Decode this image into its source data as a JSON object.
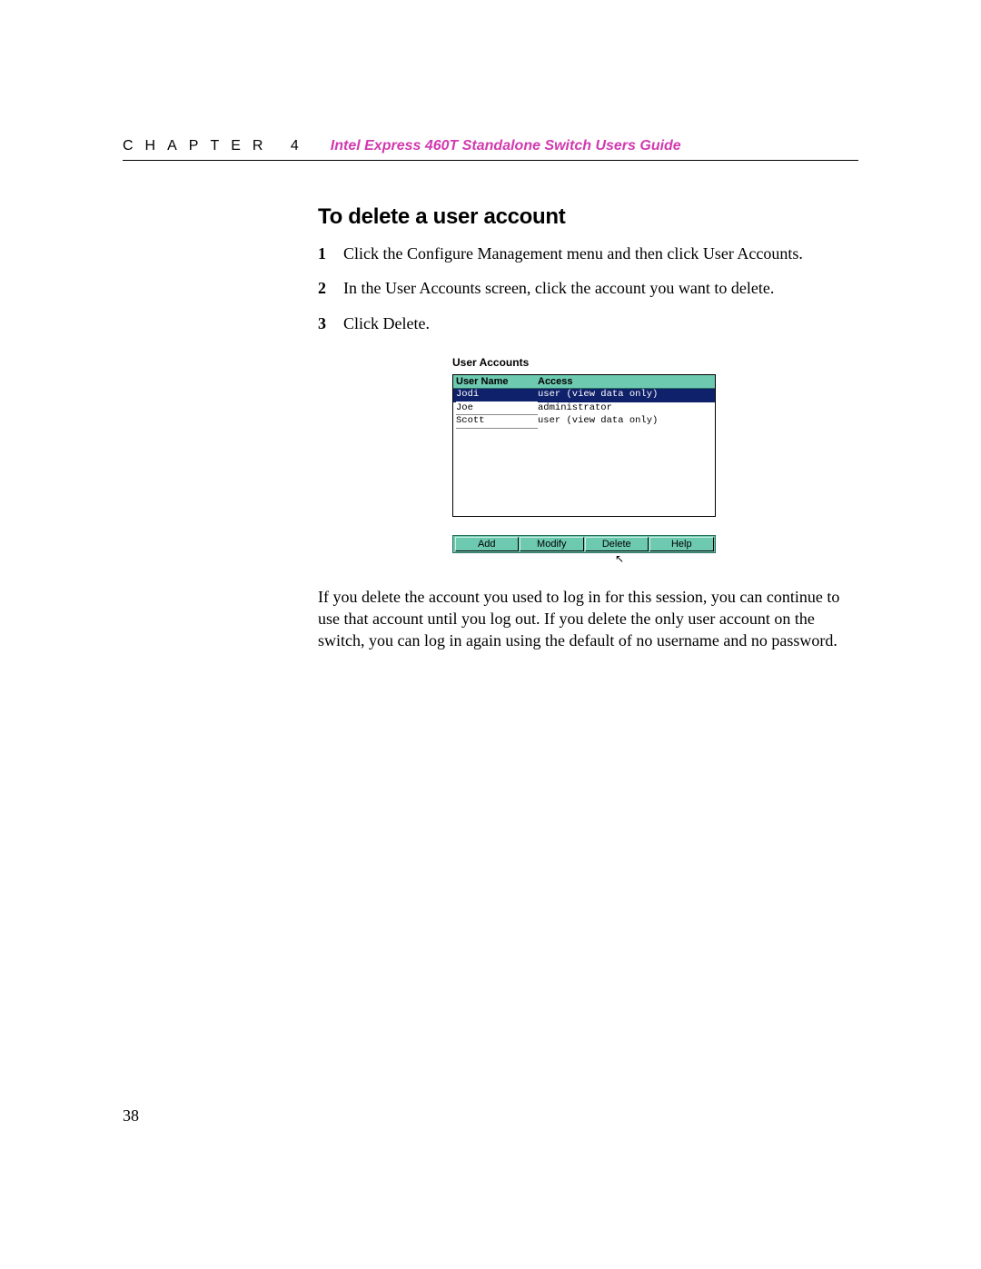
{
  "header": {
    "chapter_label": "CHAPTER 4",
    "guide_title": "Intel Express 460T Standalone Switch Users Guide"
  },
  "section": {
    "title": "To delete a user account",
    "steps": [
      "Click the Configure Management menu and then click User Accounts.",
      "In the User Accounts screen, click the account you want to delete.",
      "Click Delete."
    ],
    "closing": "If you delete the account you used to log in for this session, you can continue to use that account until you log out. If you delete the only user account on the switch, you can log in again using the default of no username and no password."
  },
  "figure": {
    "title": "User Accounts",
    "columns": {
      "name": "User Name",
      "access": "Access"
    },
    "rows": [
      {
        "name": "Jodi",
        "access": "user (view data only)",
        "selected": true
      },
      {
        "name": "Joe",
        "access": "administrator",
        "selected": false
      },
      {
        "name": "Scott",
        "access": "user (view data only)",
        "selected": false
      }
    ],
    "buttons": {
      "add": "Add",
      "modify": "Modify",
      "delete": "Delete",
      "help": "Help"
    }
  },
  "page_number": "38"
}
